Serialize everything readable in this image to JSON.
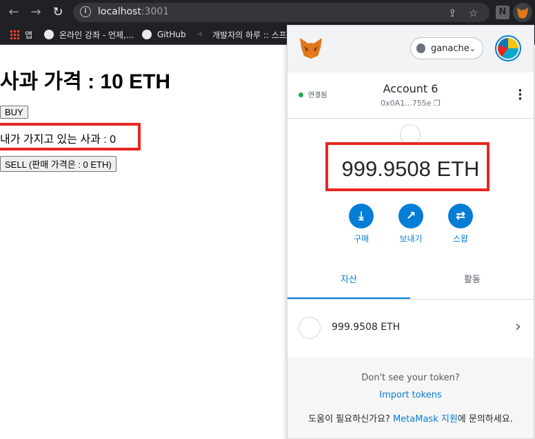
{
  "browser": {
    "url_host": "localhost",
    "url_port": ":3001",
    "extension_n_label": "N"
  },
  "bookmarks": [
    {
      "label": "앱"
    },
    {
      "label": "온라인 강좌 - 언제,..."
    },
    {
      "label": "GitHub"
    },
    {
      "label": "개발자의 하루 :: 스프..."
    }
  ],
  "page": {
    "title": "사과 가격 : 10 ETH",
    "buy_label": "BUY",
    "owned_text": "내가 가지고 있는 사과 : 0",
    "sell_label": "SELL (판매 가격은 : 0 ETH)"
  },
  "metamask": {
    "network": "ganache",
    "connection_status": "연결됨",
    "account_name": "Account 6",
    "account_address": "0x0A1...755e",
    "balance": "999.9508 ETH",
    "actions": [
      {
        "label": "구매",
        "icon": "download-icon"
      },
      {
        "label": "보내기",
        "icon": "send-arrow-icon"
      },
      {
        "label": "스왑",
        "icon": "swap-icon"
      }
    ],
    "tabs": [
      {
        "label": "자산",
        "active": true
      },
      {
        "label": "활동",
        "active": false
      }
    ],
    "asset_value": "999.9508 ETH",
    "dont_see": "Don't see your token?",
    "import_tokens": "Import tokens",
    "support_prefix": "도움이 필요하신가요? ",
    "support_link": "MetaMask 지원",
    "support_suffix": "에 문의하세요."
  },
  "colors": {
    "accent": "#037dd6",
    "highlight_box": "#e8261f",
    "connected": "#28a745"
  }
}
